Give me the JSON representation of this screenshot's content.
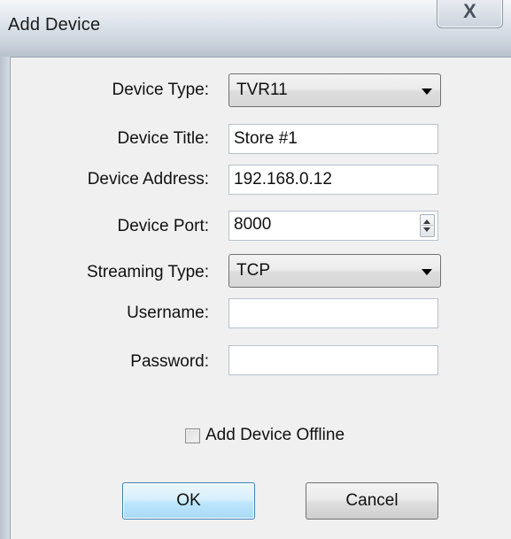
{
  "window": {
    "title": "Add Device",
    "close_glyph": "X"
  },
  "form": {
    "device_type": {
      "label": "Device Type:",
      "value": "TVR11"
    },
    "device_title": {
      "label": "Device Title:",
      "value": "Store #1"
    },
    "device_address": {
      "label": "Device Address:",
      "value": "192.168.0.12"
    },
    "device_port": {
      "label": "Device Port:",
      "value": "8000"
    },
    "streaming_type": {
      "label": "Streaming Type:",
      "value": "TCP"
    },
    "username": {
      "label": "Username:",
      "value": ""
    },
    "password": {
      "label": "Password:",
      "value": ""
    },
    "offline": {
      "label": "Add Device Offline",
      "checked": false
    }
  },
  "buttons": {
    "ok": "OK",
    "cancel": "Cancel"
  },
  "icons": {
    "close": "close-icon",
    "dropdown": "chevron-down-icon",
    "spinner": "spin-up-down-icon"
  },
  "colors": {
    "title_bar": "#cbd3dd",
    "dialog_bg": "#f0f0f0",
    "default_button": "#bee6fd"
  }
}
